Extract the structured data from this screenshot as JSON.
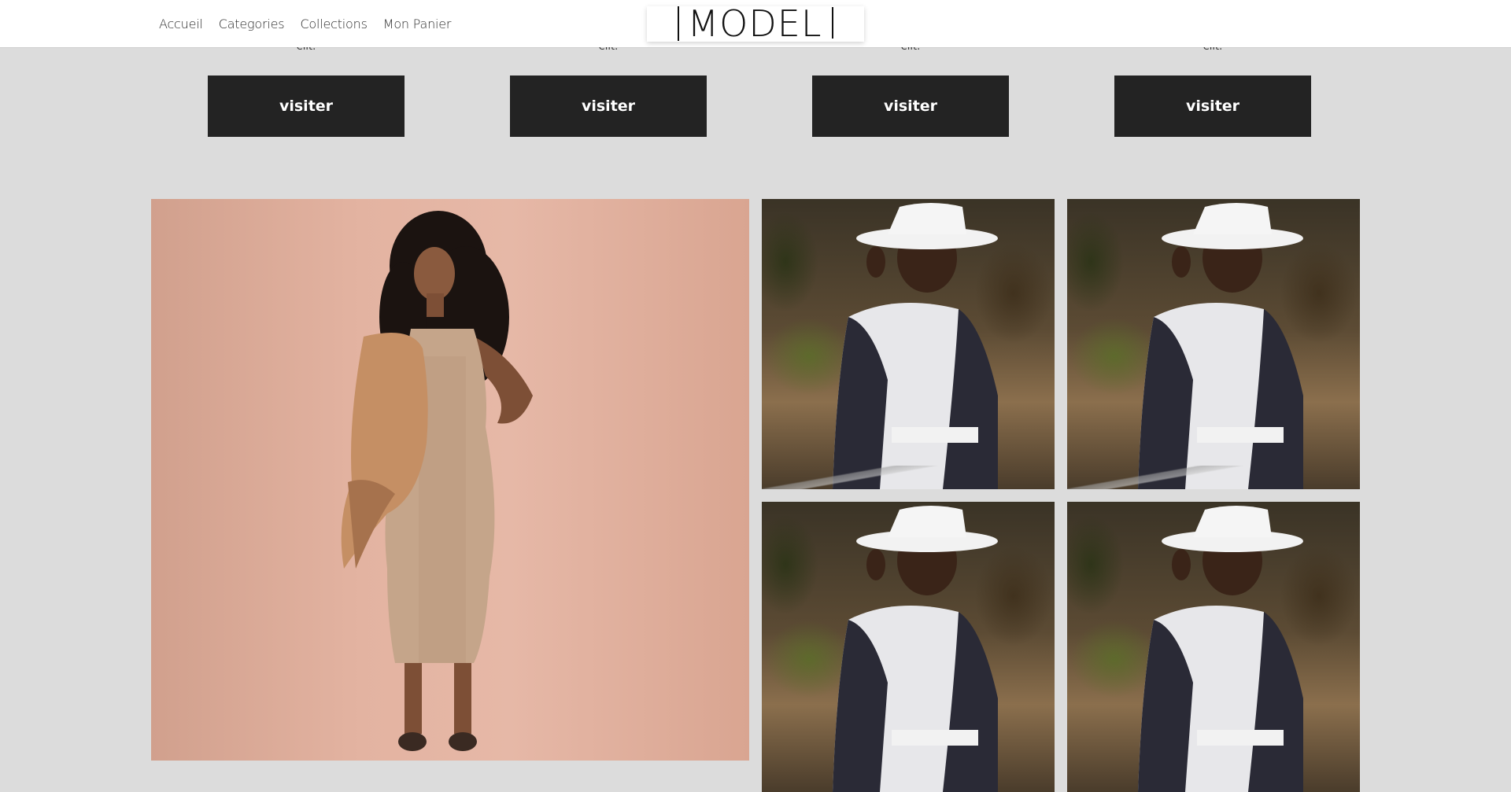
{
  "nav": {
    "items": [
      "Accueil",
      "Categories",
      "Collections",
      "Mon Panier"
    ]
  },
  "logo": {
    "text": "MODEL"
  },
  "cards": [
    {
      "text": "elit.",
      "button": "visiter"
    },
    {
      "text": "elit.",
      "button": "visiter"
    },
    {
      "text": "elit.",
      "button": "visiter"
    },
    {
      "text": "elit.",
      "button": "visiter"
    }
  ],
  "gallery": {
    "featured": "woman-beige-dress-photo",
    "tiles": [
      "woman-white-hat-photo",
      "woman-white-hat-photo",
      "woman-white-hat-photo",
      "woman-white-hat-photo"
    ]
  },
  "colors": {
    "page_background": "#dcdcdc",
    "header_background": "#ffffff",
    "button_background": "#232323",
    "button_text": "#ffffff"
  }
}
